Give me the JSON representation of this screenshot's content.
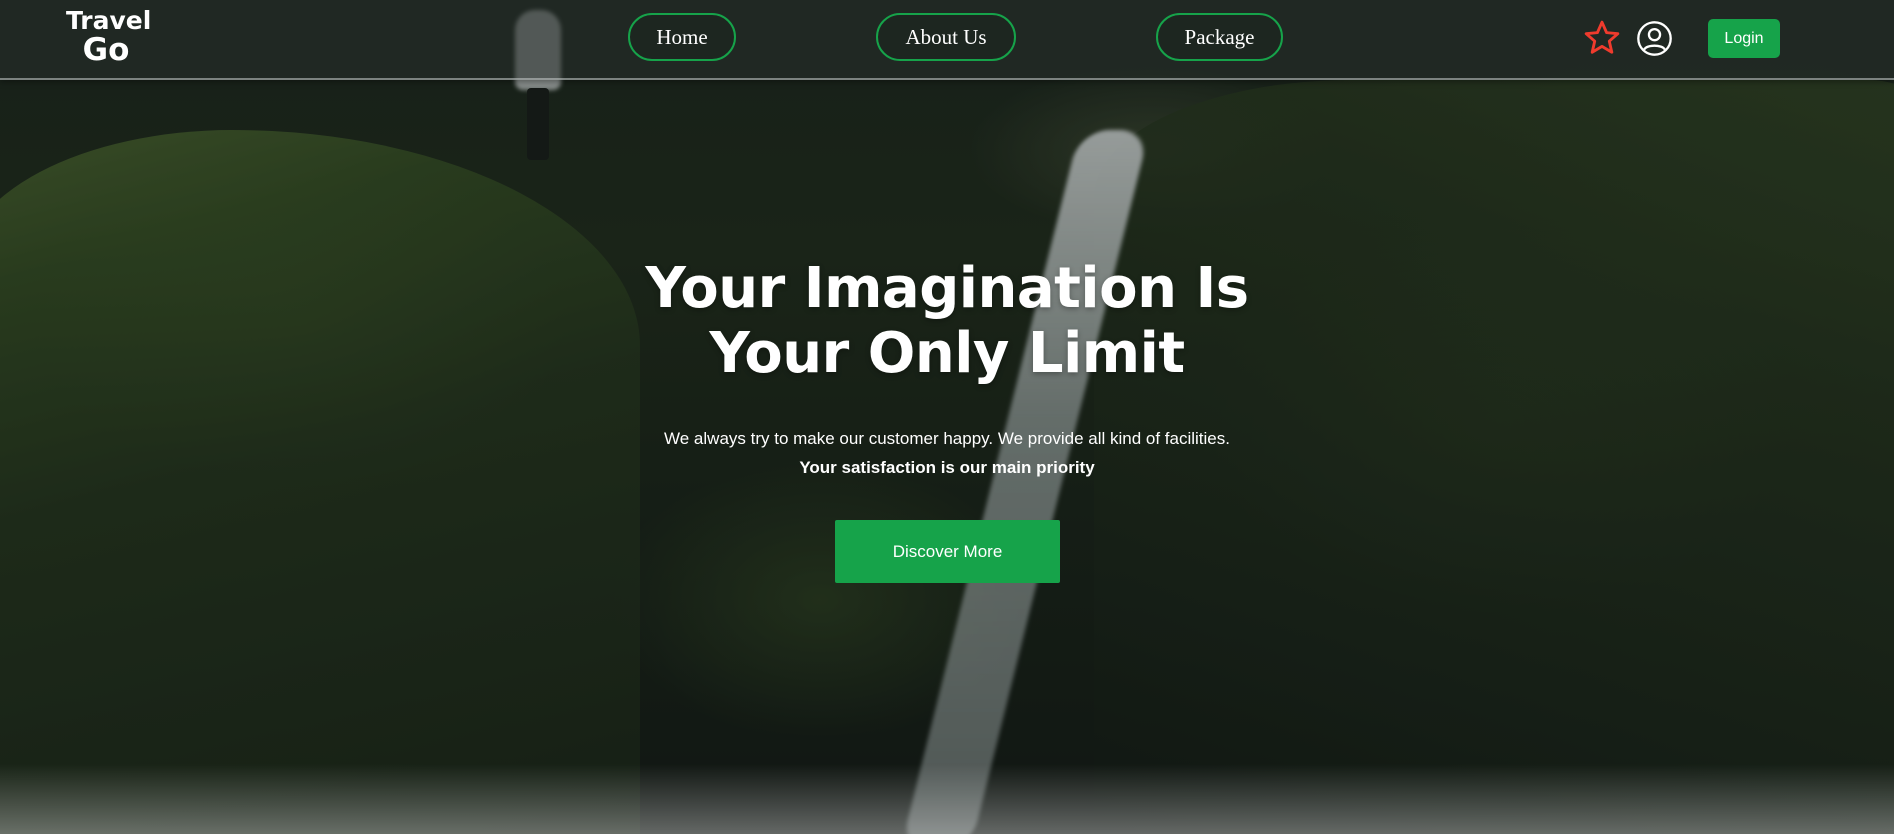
{
  "brand": {
    "line1": "Travel",
    "line2": "Go"
  },
  "nav": {
    "links": [
      {
        "label": "Home"
      },
      {
        "label": "About Us"
      },
      {
        "label": "Package"
      }
    ],
    "icons": {
      "favorite": "star-icon",
      "account": "user-circle-icon"
    },
    "login_label": "Login"
  },
  "hero": {
    "headline_line1": "Your Imagination Is",
    "headline_line2": "Your Only Limit",
    "subtitle": "We always try to make our customer happy. We provide all kind of facilities.",
    "tagline": "Your satisfaction is our main priority",
    "cta_label": "Discover More"
  },
  "colors": {
    "accent": "#16a34a",
    "star": "#ef3b2d",
    "text": "#ffffff"
  }
}
